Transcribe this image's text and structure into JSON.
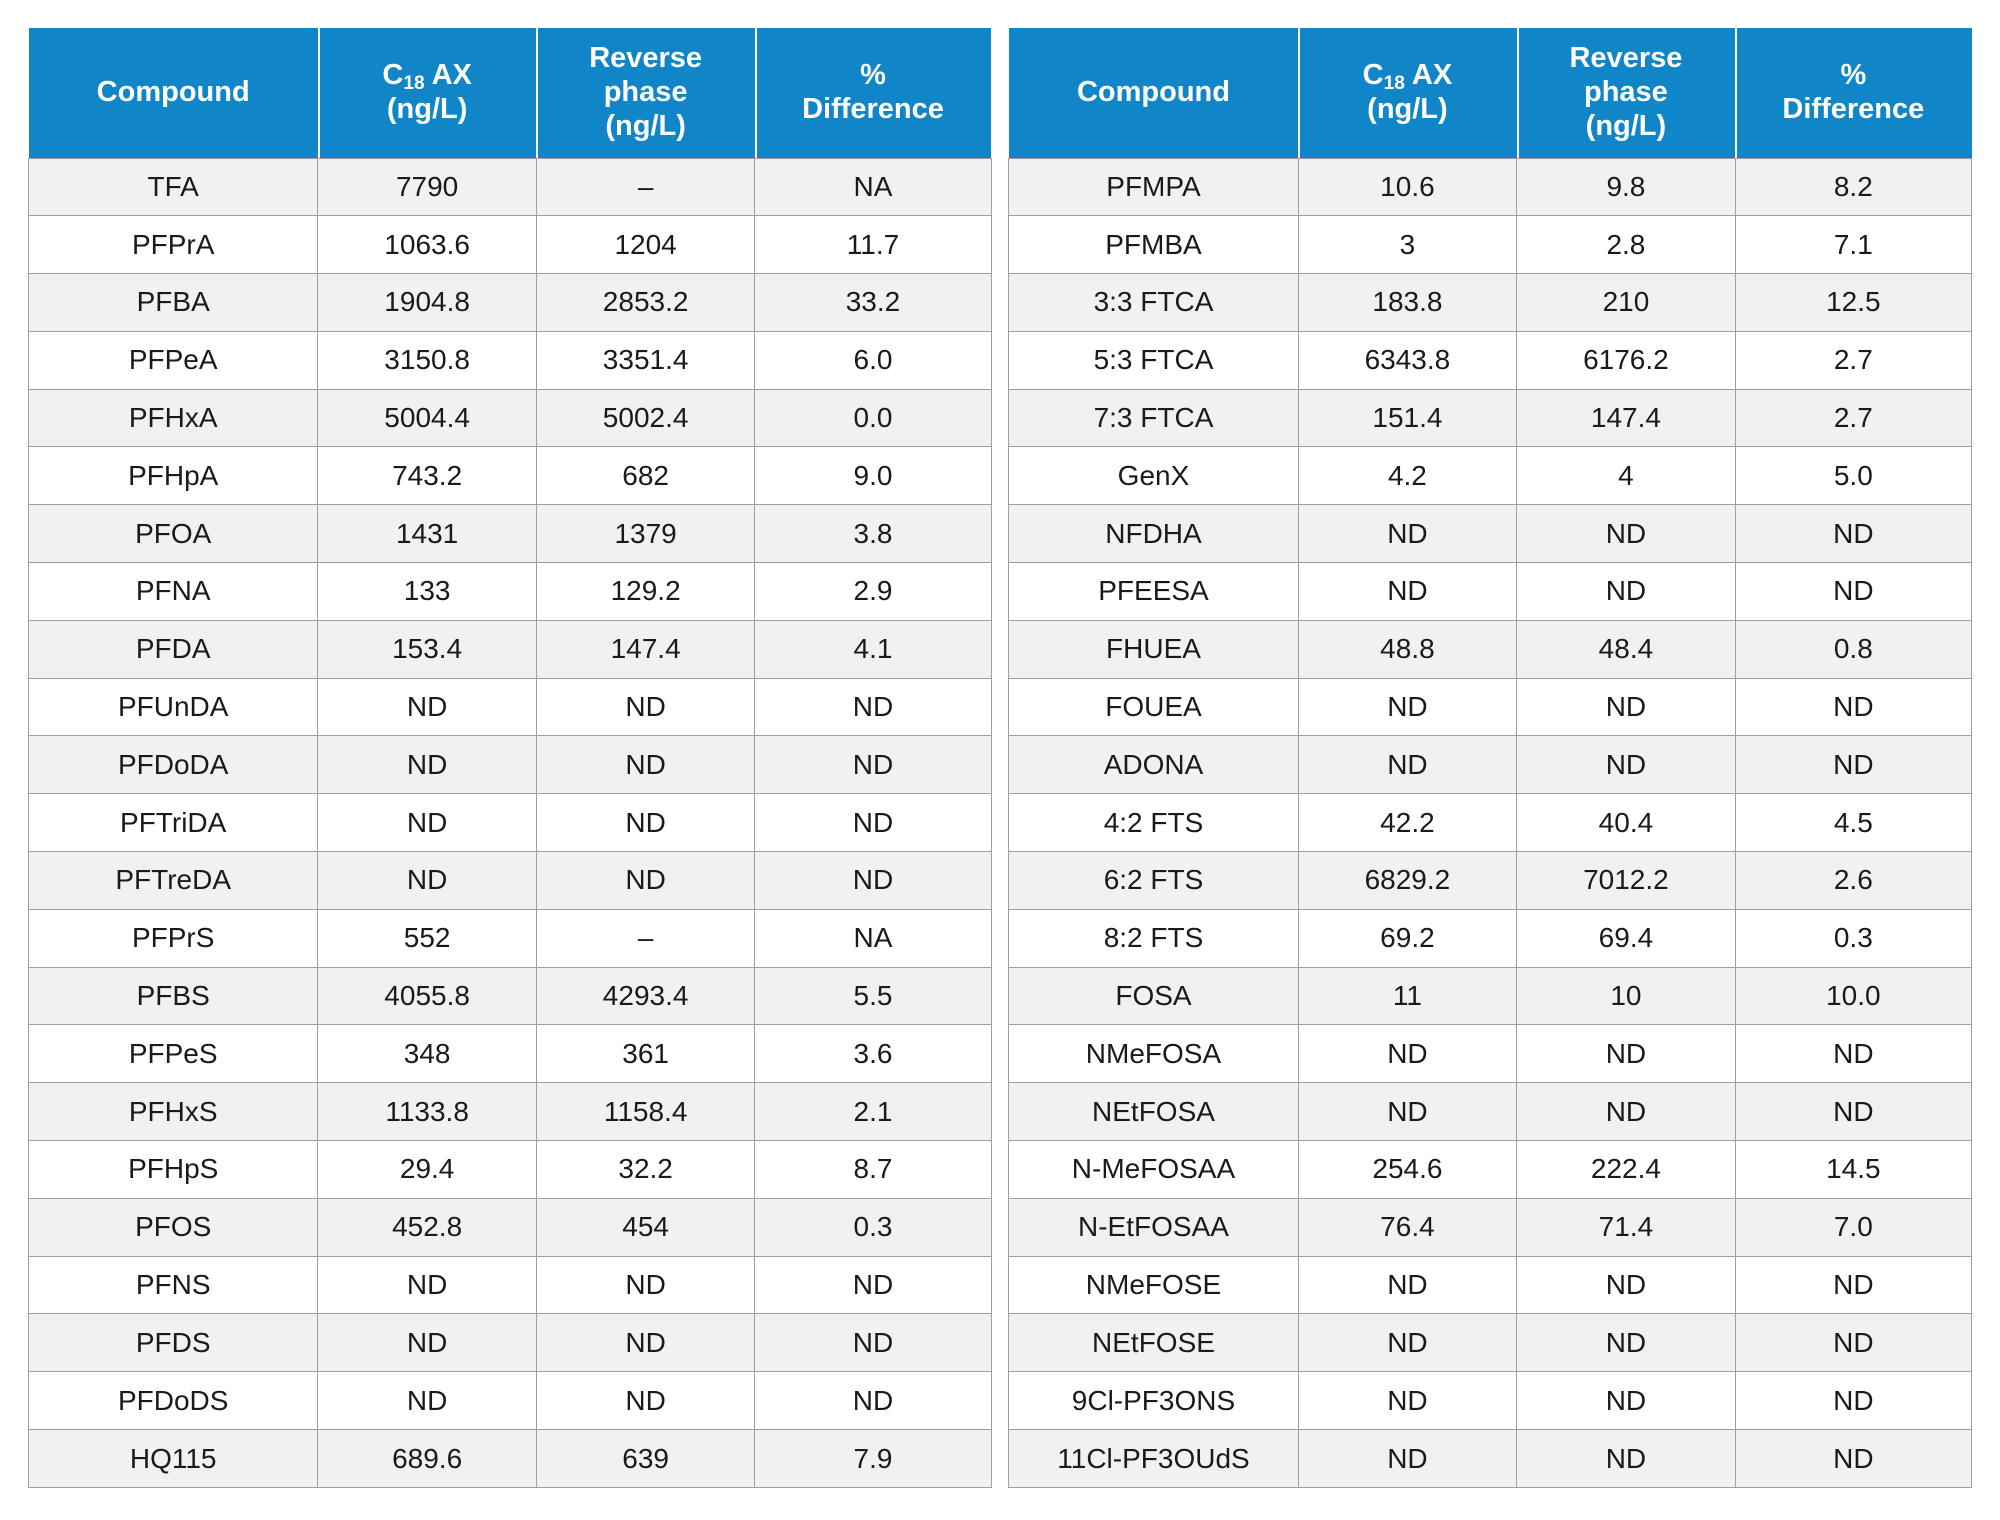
{
  "table": {
    "columns_left": [
      {
        "key": "compound",
        "label": "Compound",
        "sub": null,
        "unit": null
      },
      {
        "key": "c18ax",
        "label": "C",
        "sub": "18",
        "label_after": " AX",
        "unit": "(ng/L)"
      },
      {
        "key": "reverse",
        "label": "Reverse\nphase",
        "sub": null,
        "unit": "(ng/L)"
      },
      {
        "key": "pctdiff",
        "label": "%\nDifference",
        "sub": null,
        "unit": null
      }
    ],
    "columns_right": [
      {
        "key": "compound",
        "label": "Compound",
        "sub": null,
        "unit": null
      },
      {
        "key": "c18ax",
        "label": "C",
        "sub": "18",
        "label_after": " AX",
        "unit": "(ng/L)"
      },
      {
        "key": "reverse",
        "label": "Reverse\nphase",
        "sub": null,
        "unit": "(ng/L)"
      },
      {
        "key": "pctdiff",
        "label": "%\nDifference",
        "sub": null,
        "unit": null
      }
    ],
    "header_labels": {
      "compound": "Compound",
      "c18ax_prefix": "C",
      "c18ax_sub": "18",
      "c18ax_suffix": " AX",
      "c18ax_unit": "(ng/L)",
      "reverse_line1": "Reverse",
      "reverse_line2": "phase",
      "reverse_unit": "(ng/L)",
      "pct_line1": "%",
      "pct_line2": "Difference"
    },
    "colors": {
      "header_bg": "#1085c8",
      "header_text": "#ffffff",
      "row_alt_bg": "#f0f1f3",
      "row_bg": "#ffffff",
      "border": "#9b9fa3",
      "text": "#1a1a1a"
    },
    "rows": [
      {
        "left": [
          "TFA",
          "7790",
          "–",
          "NA"
        ],
        "right": [
          "PFMPA",
          "10.6",
          "9.8",
          "8.2"
        ]
      },
      {
        "left": [
          "PFPrA",
          "1063.6",
          "1204",
          "11.7"
        ],
        "right": [
          "PFMBA",
          "3",
          "2.8",
          "7.1"
        ]
      },
      {
        "left": [
          "PFBA",
          "1904.8",
          "2853.2",
          "33.2"
        ],
        "right": [
          "3:3 FTCA",
          "183.8",
          "210",
          "12.5"
        ]
      },
      {
        "left": [
          "PFPeA",
          "3150.8",
          "3351.4",
          "6.0"
        ],
        "right": [
          "5:3 FTCA",
          "6343.8",
          "6176.2",
          "2.7"
        ]
      },
      {
        "left": [
          "PFHxA",
          "5004.4",
          "5002.4",
          "0.0"
        ],
        "right": [
          "7:3 FTCA",
          "151.4",
          "147.4",
          "2.7"
        ]
      },
      {
        "left": [
          "PFHpA",
          "743.2",
          "682",
          "9.0"
        ],
        "right": [
          "GenX",
          "4.2",
          "4",
          "5.0"
        ]
      },
      {
        "left": [
          "PFOA",
          "1431",
          "1379",
          "3.8"
        ],
        "right": [
          "NFDHA",
          "ND",
          "ND",
          "ND"
        ]
      },
      {
        "left": [
          "PFNA",
          "133",
          "129.2",
          "2.9"
        ],
        "right": [
          "PFEESA",
          "ND",
          "ND",
          "ND"
        ]
      },
      {
        "left": [
          "PFDA",
          "153.4",
          "147.4",
          "4.1"
        ],
        "right": [
          "FHUEA",
          "48.8",
          "48.4",
          "0.8"
        ]
      },
      {
        "left": [
          "PFUnDA",
          "ND",
          "ND",
          "ND"
        ],
        "right": [
          "FOUEA",
          "ND",
          "ND",
          "ND"
        ]
      },
      {
        "left": [
          "PFDoDA",
          "ND",
          "ND",
          "ND"
        ],
        "right": [
          "ADONA",
          "ND",
          "ND",
          "ND"
        ]
      },
      {
        "left": [
          "PFTriDA",
          "ND",
          "ND",
          "ND"
        ],
        "right": [
          "4:2 FTS",
          "42.2",
          "40.4",
          "4.5"
        ]
      },
      {
        "left": [
          "PFTreDA",
          "ND",
          "ND",
          "ND"
        ],
        "right": [
          "6:2 FTS",
          "6829.2",
          "7012.2",
          "2.6"
        ]
      },
      {
        "left": [
          "PFPrS",
          "552",
          "–",
          "NA"
        ],
        "right": [
          "8:2 FTS",
          "69.2",
          "69.4",
          "0.3"
        ]
      },
      {
        "left": [
          "PFBS",
          "4055.8",
          "4293.4",
          "5.5"
        ],
        "right": [
          "FOSA",
          "11",
          "10",
          "10.0"
        ]
      },
      {
        "left": [
          "PFPeS",
          "348",
          "361",
          "3.6"
        ],
        "right": [
          "NMeFOSA",
          "ND",
          "ND",
          "ND"
        ]
      },
      {
        "left": [
          "PFHxS",
          "1133.8",
          "1158.4",
          "2.1"
        ],
        "right": [
          "NEtFOSA",
          "ND",
          "ND",
          "ND"
        ]
      },
      {
        "left": [
          "PFHpS",
          "29.4",
          "32.2",
          "8.7"
        ],
        "right": [
          "N-MeFOSAA",
          "254.6",
          "222.4",
          "14.5"
        ]
      },
      {
        "left": [
          "PFOS",
          "452.8",
          "454",
          "0.3"
        ],
        "right": [
          "N-EtFOSAA",
          "76.4",
          "71.4",
          "7.0"
        ]
      },
      {
        "left": [
          "PFNS",
          "ND",
          "ND",
          "ND"
        ],
        "right": [
          "NMeFOSE",
          "ND",
          "ND",
          "ND"
        ]
      },
      {
        "left": [
          "PFDS",
          "ND",
          "ND",
          "ND"
        ],
        "right": [
          "NEtFOSE",
          "ND",
          "ND",
          "ND"
        ]
      },
      {
        "left": [
          "PFDoDS",
          "ND",
          "ND",
          "ND"
        ],
        "right": [
          "9Cl-PF3ONS",
          "ND",
          "ND",
          "ND"
        ]
      },
      {
        "left": [
          "HQ115",
          "689.6",
          "639",
          "7.9"
        ],
        "right": [
          "11Cl-PF3OUdS",
          "ND",
          "ND",
          "ND"
        ]
      }
    ]
  }
}
